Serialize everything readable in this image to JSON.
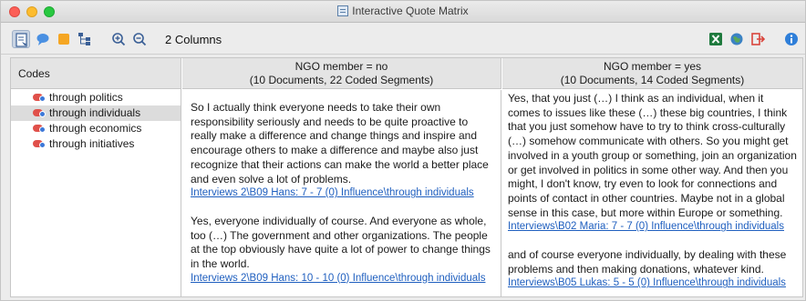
{
  "window": {
    "title": "Interactive Quote Matrix"
  },
  "toolbar": {
    "columns_label": "2 Columns",
    "left_tools": [
      "document-view-icon",
      "comment-icon",
      "color-tag-icon",
      "hierarchy-icon",
      "zoom-in-icon",
      "zoom-out-icon"
    ],
    "right_tools": [
      "excel-export-icon",
      "web-export-icon",
      "exit-icon",
      "info-icon"
    ]
  },
  "codes": {
    "header": "Codes",
    "items": [
      {
        "label": "through politics"
      },
      {
        "label": "through individuals",
        "selected": true
      },
      {
        "label": "through economics"
      },
      {
        "label": "through initiatives"
      }
    ]
  },
  "columns": [
    {
      "header_line1": "NGO member = no",
      "header_line2": "(10 Documents, 22 Coded Segments)",
      "segments": [
        {
          "text": "So I actually think everyone needs to take their own responsibility seriously and needs to be quite proactive to really make a difference and change things and inspire and encourage others to make a difference and maybe also just recognize that their actions can make the world a better place and even solve a lot of problems.",
          "link": "Interviews 2\\B09 Hans: 7 - 7  (0) Influence\\through individuals"
        },
        {
          "text": "Yes, everyone individually of course. And everyone as whole, too (…) The government and other organizations. The people at the top obviously have quite a lot of power to change things in the world.",
          "link": "Interviews 2\\B09 Hans: 10 - 10  (0) Influence\\through individuals"
        }
      ]
    },
    {
      "header_line1": "NGO member = yes",
      "header_line2": "(10 Documents, 14 Coded Segments)",
      "segments": [
        {
          "text": "Yes, that you just (…) I think as an individual, when it comes to issues like these (…) these big countries, I think that you just somehow have to try to think cross-culturally (…) somehow communicate with others. So you might get involved in a youth group or something, join an organization or get involved in politics in some other way. And then you might, I don't know, try even to look for connections and points of contact in other countries. Maybe not in a global sense in this case, but more within Europe or something.",
          "link": "Interviews\\B02 Maria: 7 - 7  (0) Influence\\through individuals"
        },
        {
          "text": "and of course everyone individually, by dealing with these problems and then making donations, whatever kind.",
          "link": "Interviews\\B05 Lukas: 5 - 5  (0) Influence\\through individuals"
        }
      ]
    }
  ],
  "colors": {
    "link": "#1f5fbf",
    "selection": "#dcdcdc",
    "header_bg": "#e4e4e4"
  }
}
